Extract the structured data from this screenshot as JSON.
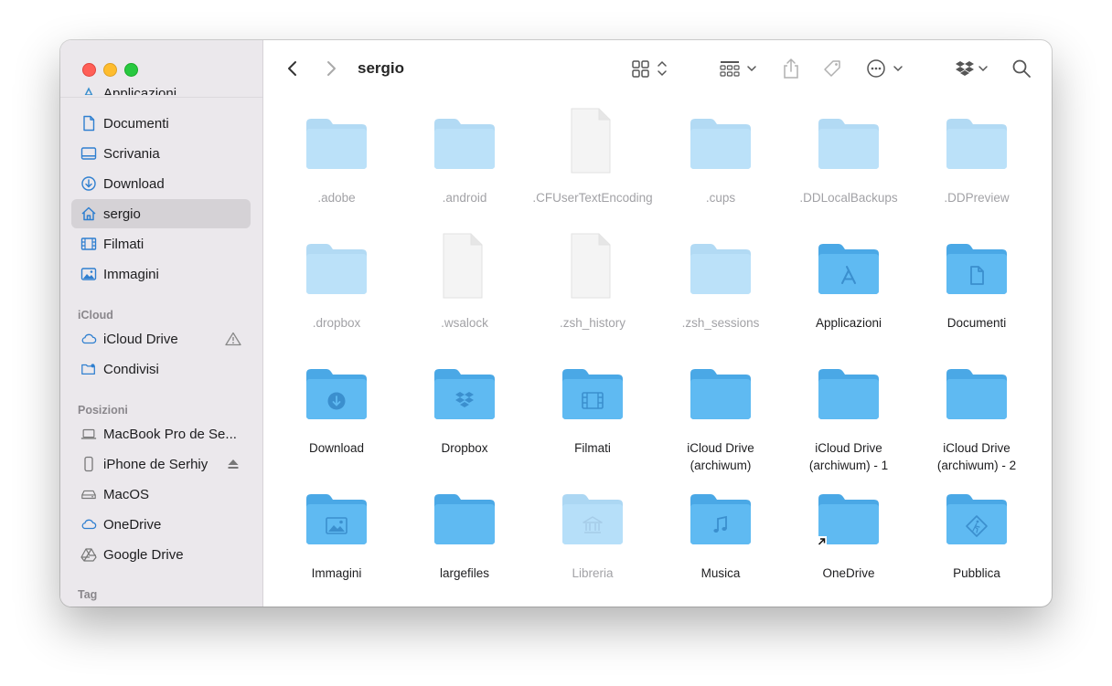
{
  "window": {
    "title": "sergio"
  },
  "sidebar": {
    "partial_item": "Applicazioni",
    "favorites": [
      {
        "label": "Documenti",
        "icon": "doc-icon"
      },
      {
        "label": "Scrivania",
        "icon": "desktop-icon"
      },
      {
        "label": "Download",
        "icon": "download-circle-icon"
      },
      {
        "label": "sergio",
        "icon": "home-icon",
        "selected": true
      },
      {
        "label": "Filmati",
        "icon": "film-icon"
      },
      {
        "label": "Immagini",
        "icon": "photo-icon"
      }
    ],
    "icloud_header": "iCloud",
    "icloud": [
      {
        "label": "iCloud Drive",
        "icon": "cloud-icon",
        "right_icon": "warning-icon"
      },
      {
        "label": "Condivisi",
        "icon": "shared-folder-icon"
      }
    ],
    "locations_header": "Posizioni",
    "locations": [
      {
        "label": "MacBook Pro de Se...",
        "icon": "laptop-icon"
      },
      {
        "label": "iPhone de Serhiy",
        "icon": "iphone-icon",
        "right_icon": "eject-icon"
      },
      {
        "label": "MacOS",
        "icon": "drive-icon"
      },
      {
        "label": "OneDrive",
        "icon": "cloud-icon"
      },
      {
        "label": "Google Drive",
        "icon": "google-drive-icon"
      }
    ],
    "tags_header": "Tag"
  },
  "toolbar": {
    "back": "chevron-left-icon",
    "forward": "chevron-right-icon",
    "view": "icon-grid-icon",
    "group": "group-by-icon",
    "share": "share-icon",
    "tag": "tag-icon",
    "more": "ellipsis-circle-icon",
    "dropbox": "dropbox-icon",
    "search": "search-icon"
  },
  "items": [
    {
      "name": ".adobe",
      "kind": "folder-light",
      "faded": true
    },
    {
      "name": ".android",
      "kind": "folder-light",
      "faded": true
    },
    {
      "name": ".CFUserTextEncoding",
      "kind": "file",
      "faded": true
    },
    {
      "name": ".cups",
      "kind": "folder-light",
      "faded": true
    },
    {
      "name": ".DDLocalBackups",
      "kind": "folder-light",
      "faded": true
    },
    {
      "name": ".DDPreview",
      "kind": "folder-light",
      "faded": true
    },
    {
      "name": ".dropbox",
      "kind": "folder-light",
      "faded": true
    },
    {
      "name": ".wsalock",
      "kind": "file",
      "faded": true
    },
    {
      "name": ".zsh_history",
      "kind": "file",
      "faded": true
    },
    {
      "name": ".zsh_sessions",
      "kind": "folder-light",
      "faded": true
    },
    {
      "name": "Applicazioni",
      "kind": "folder",
      "glyph": "apps",
      "faded": false
    },
    {
      "name": "Documenti",
      "kind": "folder",
      "glyph": "doc",
      "faded": false
    },
    {
      "name": "Download",
      "kind": "folder",
      "glyph": "download",
      "faded": false
    },
    {
      "name": "Dropbox",
      "kind": "folder",
      "glyph": "dropbox",
      "faded": false
    },
    {
      "name": "Filmati",
      "kind": "folder",
      "glyph": "film",
      "faded": false
    },
    {
      "name": "iCloud Drive (archiwum)",
      "kind": "folder",
      "glyph": "",
      "faded": false
    },
    {
      "name": "iCloud Drive (archiwum) - 1",
      "kind": "folder",
      "glyph": "",
      "faded": false
    },
    {
      "name": "iCloud Drive (archiwum) - 2",
      "kind": "folder",
      "glyph": "",
      "faded": false
    },
    {
      "name": "Immagini",
      "kind": "folder",
      "glyph": "photo",
      "faded": false
    },
    {
      "name": "largefiles",
      "kind": "folder",
      "glyph": "",
      "faded": false
    },
    {
      "name": "Libreria",
      "kind": "folder",
      "glyph": "library",
      "faded": true
    },
    {
      "name": "Musica",
      "kind": "folder",
      "glyph": "music",
      "faded": false
    },
    {
      "name": "OneDrive",
      "kind": "folder",
      "glyph": "alias",
      "faded": false
    },
    {
      "name": "Pubblica",
      "kind": "folder",
      "glyph": "public",
      "faded": false
    }
  ],
  "colors": {
    "folder_back": "#4aa8e6",
    "folder_front": "#5fbaf2",
    "folder_glyph": "#3b8fce",
    "selection": "#d5d2d6",
    "sidebar_bg": "#ebe8ec"
  }
}
